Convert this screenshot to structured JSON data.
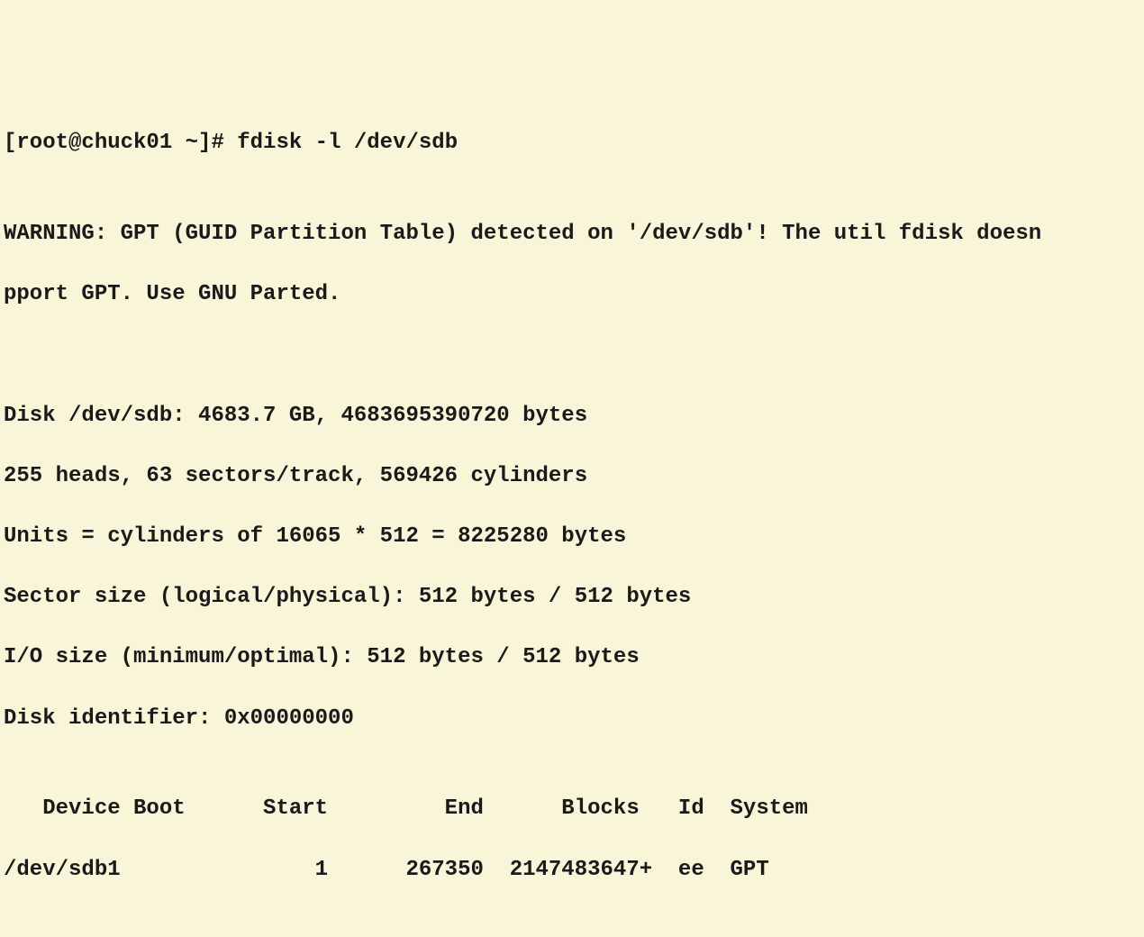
{
  "terminal": {
    "prompt": "[root@chuck01 ~]# ",
    "command": "fdisk -l /dev/sdb",
    "blank1": "",
    "warning_line1": "WARNING: GPT (GUID Partition Table) detected on '/dev/sdb'! The util fdisk doesn",
    "warning_line2": "pport GPT. Use GNU Parted.",
    "blank2": "",
    "blank3": "",
    "disk_size": "Disk /dev/sdb: 4683.7 GB, 4683695390720 bytes",
    "geometry": "255 heads, 63 sectors/track, 569426 cylinders",
    "units": "Units = cylinders of 16065 * 512 = 8225280 bytes",
    "sector_size": "Sector size (logical/physical): 512 bytes / 512 bytes",
    "io_size": "I/O size (minimum/optimal): 512 bytes / 512 bytes",
    "disk_id": "Disk identifier: 0x00000000",
    "blank4": "",
    "table_header": "   Device Boot      Start         End      Blocks   Id  System",
    "table_row1": "/dev/sdb1               1      267350  2147483647+  ee  GPT"
  }
}
